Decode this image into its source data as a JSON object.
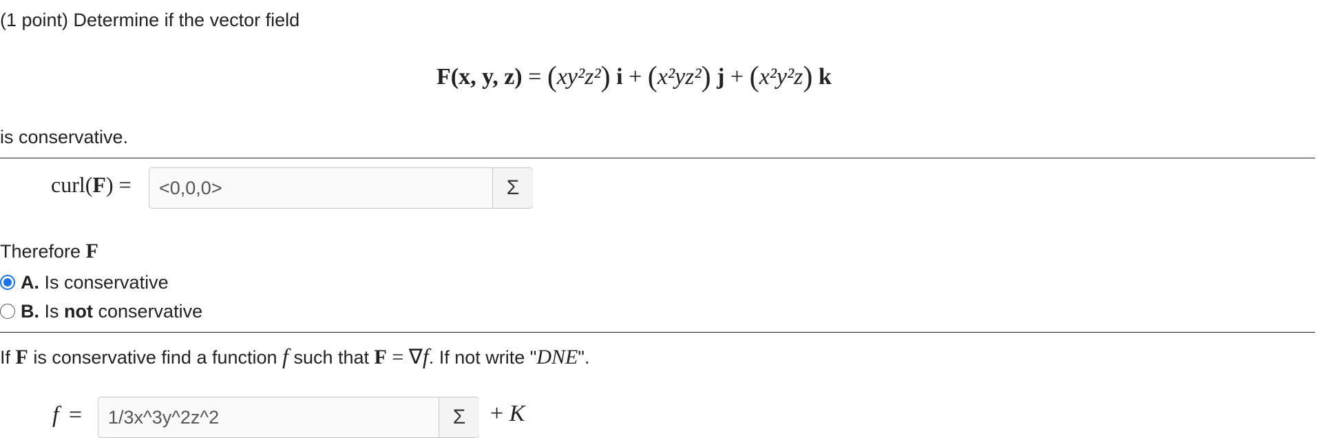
{
  "problem": {
    "points_text": "(1 point) Determine if the vector field",
    "equation": {
      "lhs": "F(x, y, z)",
      "equals": "=",
      "term_i": "xy²z²",
      "term_j": "x²yz²",
      "term_k": "x²y²z",
      "i": "i",
      "j": "j",
      "k": "k",
      "plus": "+"
    },
    "is_conservative_text": "is conservative."
  },
  "curl": {
    "label_func": "curl(",
    "label_F": "F",
    "label_close": ") =",
    "value": "<0,0,0>",
    "sigma": "Σ"
  },
  "therefore": {
    "text": "Therefore",
    "F": "F"
  },
  "options": [
    {
      "letter": "A.",
      "text_before": "Is conservative",
      "bold_word": "",
      "text_after": "",
      "checked": true
    },
    {
      "letter": "B.",
      "text_before": "Is ",
      "bold_word": "not",
      "text_after": " conservative",
      "checked": false
    }
  ],
  "potential": {
    "t1": "If ",
    "F1": "F",
    "t2": " is conservative find a function ",
    "f": "f",
    "t3": " such that ",
    "F2": "F",
    "eq": " = ∇",
    "f2": "f",
    "t4": ". If not write \"",
    "dne": "DNE",
    "t5": "\".",
    "f_label": "f",
    "equals": "=",
    "value": "1/3x^3y^2z^2",
    "sigma": "Σ",
    "plus_K": "+ ",
    "K": "K"
  },
  "colors": {
    "radio_accent": "#1a73e8"
  }
}
